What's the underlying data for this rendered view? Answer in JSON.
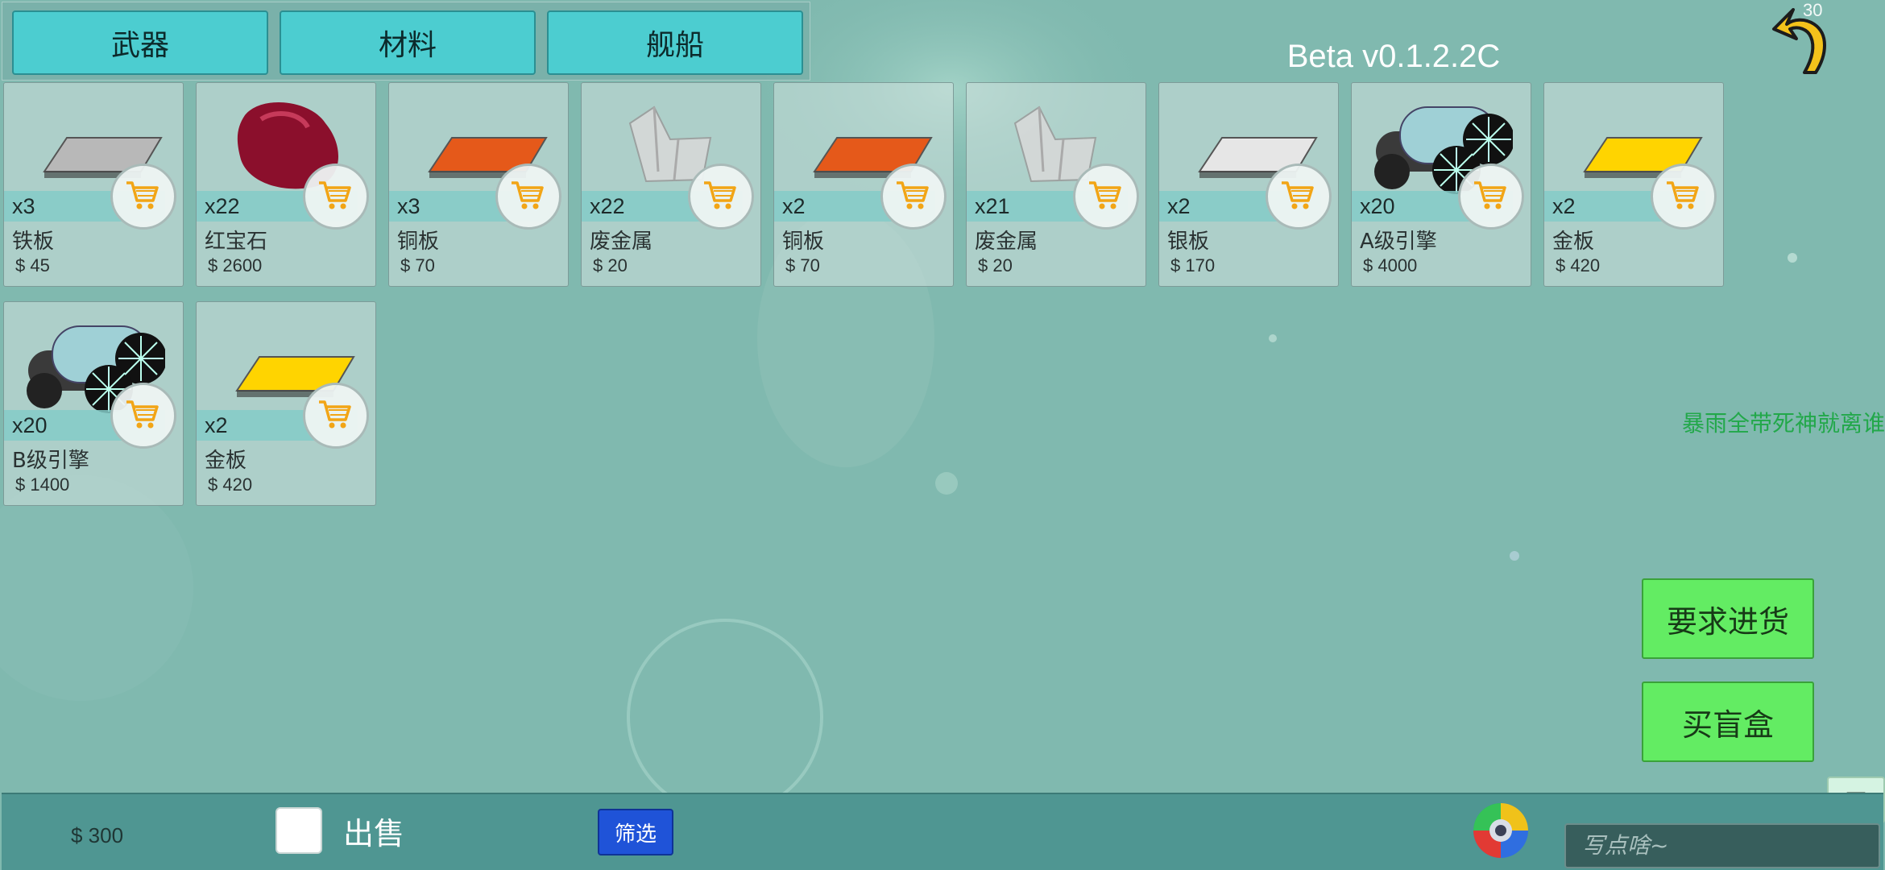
{
  "tabs": [
    {
      "label": "武器"
    },
    {
      "label": "材料"
    },
    {
      "label": "舰船"
    }
  ],
  "version": "Beta v0.1.2.2C",
  "counter": "30",
  "items": [
    {
      "qty": "x3",
      "name": "铁板",
      "price": "$ 45",
      "art": "plate-gray-icon",
      "color": "#b8b8b8"
    },
    {
      "qty": "x22",
      "name": "红宝石",
      "price": "$ 2600",
      "art": "ruby-gem-icon",
      "color": "#8b0f2c"
    },
    {
      "qty": "x3",
      "name": "铜板",
      "price": "$ 70",
      "art": "plate-copper-icon",
      "color": "#e5591a"
    },
    {
      "qty": "x22",
      "name": "废金属",
      "price": "$ 20",
      "art": "scrap-metal-icon",
      "color": "#d9d9d9"
    },
    {
      "qty": "x2",
      "name": "铜板",
      "price": "$ 70",
      "art": "plate-copper-icon",
      "color": "#e5591a"
    },
    {
      "qty": "x21",
      "name": "废金属",
      "price": "$ 20",
      "art": "scrap-metal-icon",
      "color": "#d9d9d9"
    },
    {
      "qty": "x2",
      "name": "银板",
      "price": "$ 170",
      "art": "plate-silver-icon",
      "color": "#e6e6e6"
    },
    {
      "qty": "x20",
      "name": "A级引擎",
      "price": "$ 4000",
      "art": "engine-icon",
      "color": "#9fd0d6"
    },
    {
      "qty": "x2",
      "name": "金板",
      "price": "$ 420",
      "art": "plate-gold-icon",
      "color": "#ffd400"
    },
    {
      "qty": "x20",
      "name": "B级引擎",
      "price": "$ 1400",
      "art": "engine-icon",
      "color": "#9fd0d6"
    },
    {
      "qty": "x2",
      "name": "金板",
      "price": "$ 420",
      "art": "plate-gold-icon",
      "color": "#ffd400"
    }
  ],
  "ticker": "暴雨全带死神就离谁",
  "actions": {
    "restock": "要求进货",
    "blind_box": "买盲盒"
  },
  "menu_label": "三",
  "bottom": {
    "money": "$ 300",
    "sell_label": "出售",
    "filter_label": "筛选",
    "chat_placeholder": "写点啥~"
  },
  "colors": {
    "tab": "#4ccdd0",
    "action_button": "#63ec63",
    "filter_button": "#1f53d8",
    "bottom_bar": "#4f9692",
    "cart_icon": "#f2a516"
  }
}
